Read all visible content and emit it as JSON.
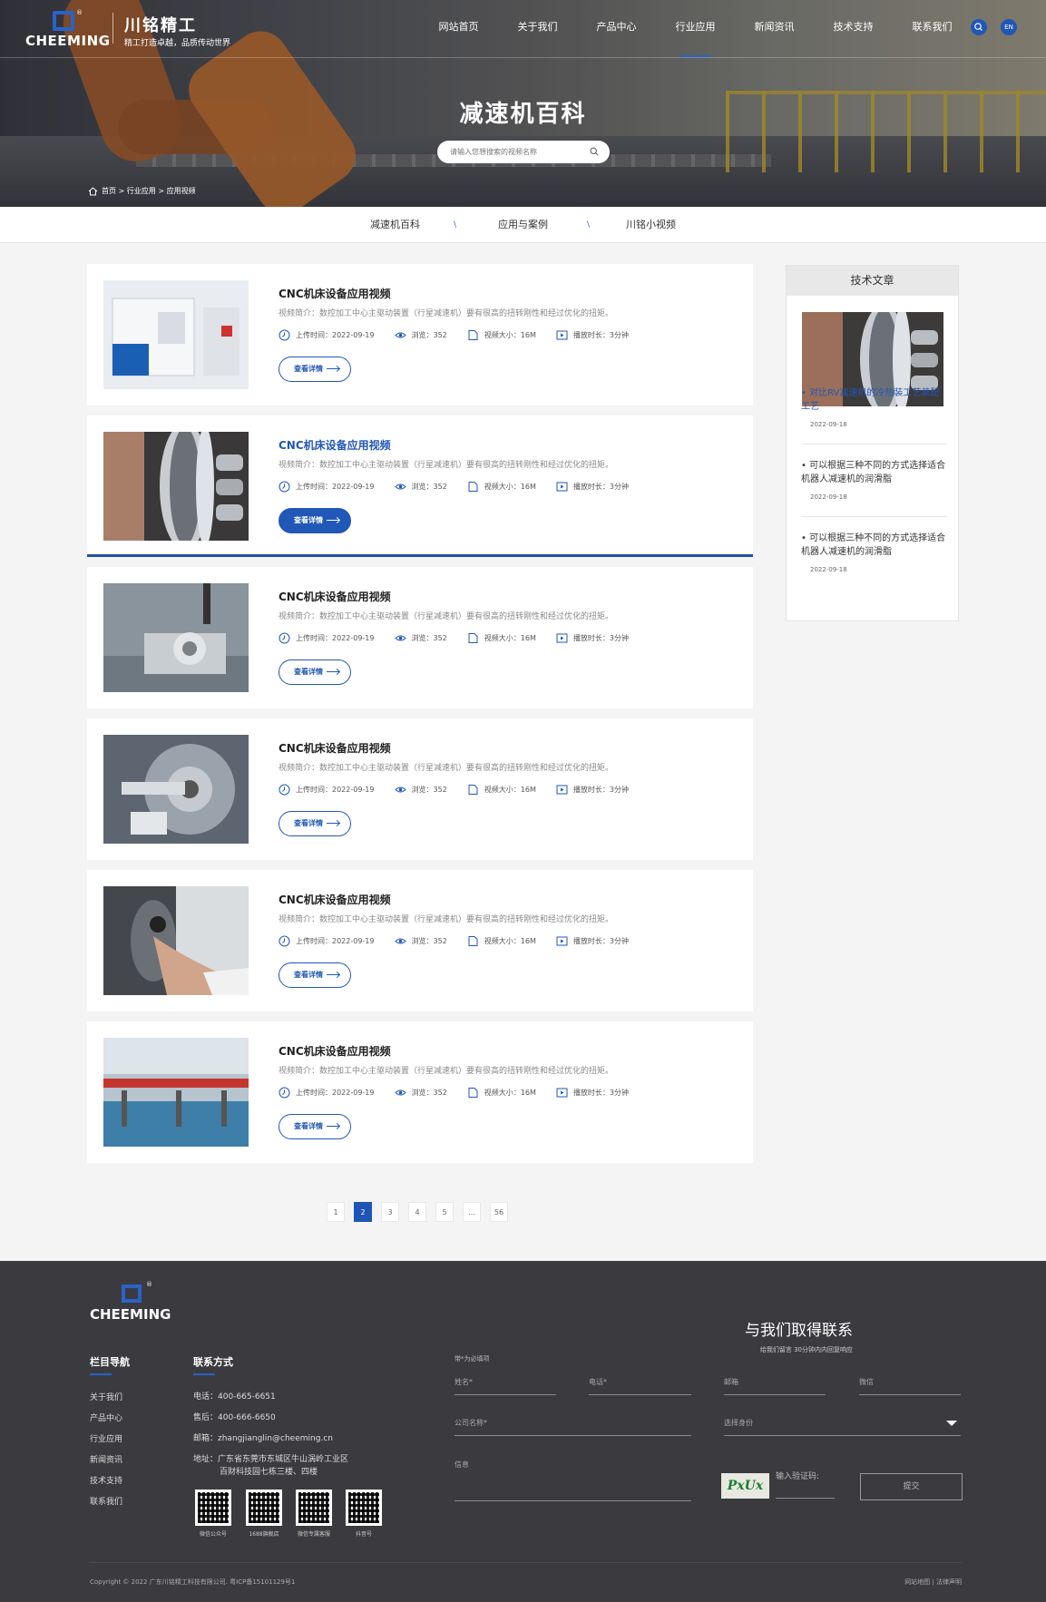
{
  "header": {
    "brand": "川铭精工",
    "slogan": "精工打造卓越，品质传动世界",
    "logo_text": "CHEEMING",
    "nav": [
      "网站首页",
      "关于我们",
      "产品中心",
      "行业应用",
      "新闻资讯",
      "技术支持",
      "联系我们"
    ],
    "active_nav": 3,
    "lang": "EN"
  },
  "hero": {
    "title": "减速机百科",
    "search_placeholder": "请输入您想搜索的视频名称",
    "breadcrumb": "首页 > 行业应用 > 应用视频"
  },
  "subnav": [
    "减速机百科",
    "应用与案例",
    "川铭小视频"
  ],
  "articles": [
    {
      "title": "CNC机床设备应用视频",
      "desc": "视频简介：数控加工中心主驱动装置（行星减速机）要有很高的扭转刚性和经过优化的扭矩。",
      "upload": "上传时间：2022-09-19",
      "views": "浏览：352",
      "size": "视频大小：16M",
      "duration": "播放时长：3分钟",
      "btn": "查看详情"
    },
    {
      "title": "CNC机床设备应用视频",
      "desc": "视频简介：数控加工中心主驱动装置（行星减速机）要有很高的扭转刚性和经过优化的扭矩。",
      "upload": "上传时间：2022-09-19",
      "views": "浏览：352",
      "size": "视频大小：16M",
      "duration": "播放时长：3分钟",
      "btn": "查看详情"
    },
    {
      "title": "CNC机床设备应用视频",
      "desc": "视频简介：数控加工中心主驱动装置（行星减速机）要有很高的扭转刚性和经过优化的扭矩。",
      "upload": "上传时间：2022-09-19",
      "views": "浏览：352",
      "size": "视频大小：16M",
      "duration": "播放时长：3分钟",
      "btn": "查看详情"
    },
    {
      "title": "CNC机床设备应用视频",
      "desc": "视频简介：数控加工中心主驱动装置（行星减速机）要有很高的扭转刚性和经过优化的扭矩。",
      "upload": "上传时间：2022-09-19",
      "views": "浏览：352",
      "size": "视频大小：16M",
      "duration": "播放时长：3分钟",
      "btn": "查看详情"
    },
    {
      "title": "CNC机床设备应用视频",
      "desc": "视频简介：数控加工中心主驱动装置（行星减速机）要有很高的扭转刚性和经过优化的扭矩。",
      "upload": "上传时间：2022-09-19",
      "views": "浏览：352",
      "size": "视频大小：16M",
      "duration": "播放时长：3分钟",
      "btn": "查看详情"
    },
    {
      "title": "CNC机床设备应用视频",
      "desc": "视频简介：数控加工中心主驱动装置（行星减速机）要有很高的扭转刚性和经过优化的扭矩。",
      "upload": "上传时间：2022-09-19",
      "views": "浏览：352",
      "size": "视频大小：16M",
      "duration": "播放时长：3分钟",
      "btn": "查看详情"
    }
  ],
  "sidebar": {
    "title": "技术文章",
    "items": [
      {
        "title": "• 对比RV减速机的冷热装工艺装配工艺",
        "date": "2022-09-18"
      },
      {
        "title": "• 可以根据三种不同的方式选择适合机器人减速机的润滑脂",
        "date": "2022-09-18"
      },
      {
        "title": "• 可以根据三种不同的方式选择适合机器人减速机的润滑脂",
        "date": "2022-09-18"
      }
    ]
  },
  "pagination": [
    "1",
    "2",
    "3",
    "4",
    "5",
    "...",
    "56"
  ],
  "current_page": "2",
  "footer": {
    "logo_text": "CHEEMING",
    "nav_title": "栏目导航",
    "nav": [
      "关于我们",
      "产品中心",
      "行业应用",
      "新闻资讯",
      "技术支持",
      "联系我们"
    ],
    "contact_title": "联系方式",
    "phone": "电话：400-665-6651",
    "aftersale": "售后：400-666-6650",
    "email": "邮箱：zhangjianglin@cheeming.cn",
    "address": "地址：广东省东莞市东城区牛山涡岭工业区",
    "address2": "百财科技园七栋三楼、四楼",
    "qrcodes": [
      "微信公众号",
      "1688旗舰店",
      "微信专属客服",
      "抖音号"
    ],
    "form_title": "与我们取得联系",
    "form_sub": "给我们留言 30分钟内内回复响应",
    "required_note": "带*为必填项",
    "fields": {
      "name": "姓名*",
      "phone": "电话*",
      "email": "邮箱",
      "wechat": "微信",
      "company": "公司名称*",
      "identity": "选择身份",
      "message": "信息",
      "captcha_label": "输入验证码:",
      "captcha_text": "PxUx"
    },
    "submit": "提交",
    "copyright": "Copyright © 2022 广东川铭精工科技有限公司. 粤ICP备15101129号1",
    "links": "网站地图 | 法律声明"
  }
}
